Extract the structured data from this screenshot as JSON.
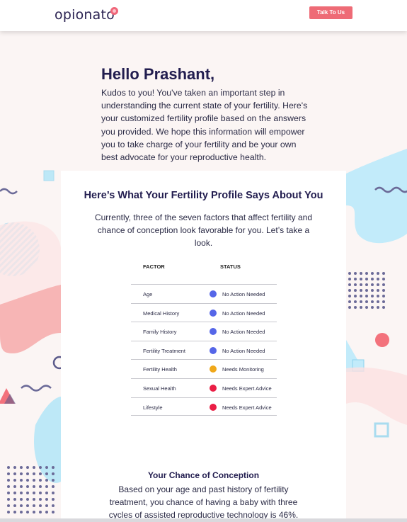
{
  "header": {
    "logo_text": "opionato",
    "cta_label": "Talk To Us"
  },
  "intro": {
    "greeting": "Hello Prashant,",
    "message": "Kudos to you! You've taken an important step in understanding the current state of your fertility. Here's your customized fertility profile based on the answers you provided. We hope this information will empower you to take charge of your fertility and be your own best advocate for your reproductive health."
  },
  "profile": {
    "title": "Here’s What Your Fertility Profile Says About You",
    "subtitle": "Currently, three of the seven factors that affect fertility and chance of conception look favorable for you. Let’s take a look.",
    "columns": {
      "factor": "FACTOR",
      "status": "STATUS"
    },
    "rows": [
      {
        "factor": "Age",
        "status": "No Action Needed",
        "color": "#5566e8"
      },
      {
        "factor": "Medical History",
        "status": "No Action Needed",
        "color": "#5566e8"
      },
      {
        "factor": "Family History",
        "status": "No Action Needed",
        "color": "#5566e8"
      },
      {
        "factor": "Fertility Treatment",
        "status": "No Action Needed",
        "color": "#5566e8"
      },
      {
        "factor": "Fertility Health",
        "status": "Needs Monitoring",
        "color": "#f0a81a"
      },
      {
        "factor": "Sexual Health",
        "status": "Needs Expert Advice",
        "color": "#ea1e45"
      },
      {
        "factor": "Lifestyle",
        "status": "Needs Expert Advice",
        "color": "#ea1e45"
      }
    ]
  },
  "conception": {
    "title": "Your Chance of Conception",
    "text": "Based on your age and past history of fertility treatment, you chance of having a baby with three cycles of assisted reproductive technology is 46%."
  },
  "colors": {
    "brand_navy": "#221d4f",
    "accent_pink": "#ee6b76",
    "good": "#5566e8",
    "monitor": "#f0a81a",
    "alert": "#ea1e45"
  }
}
